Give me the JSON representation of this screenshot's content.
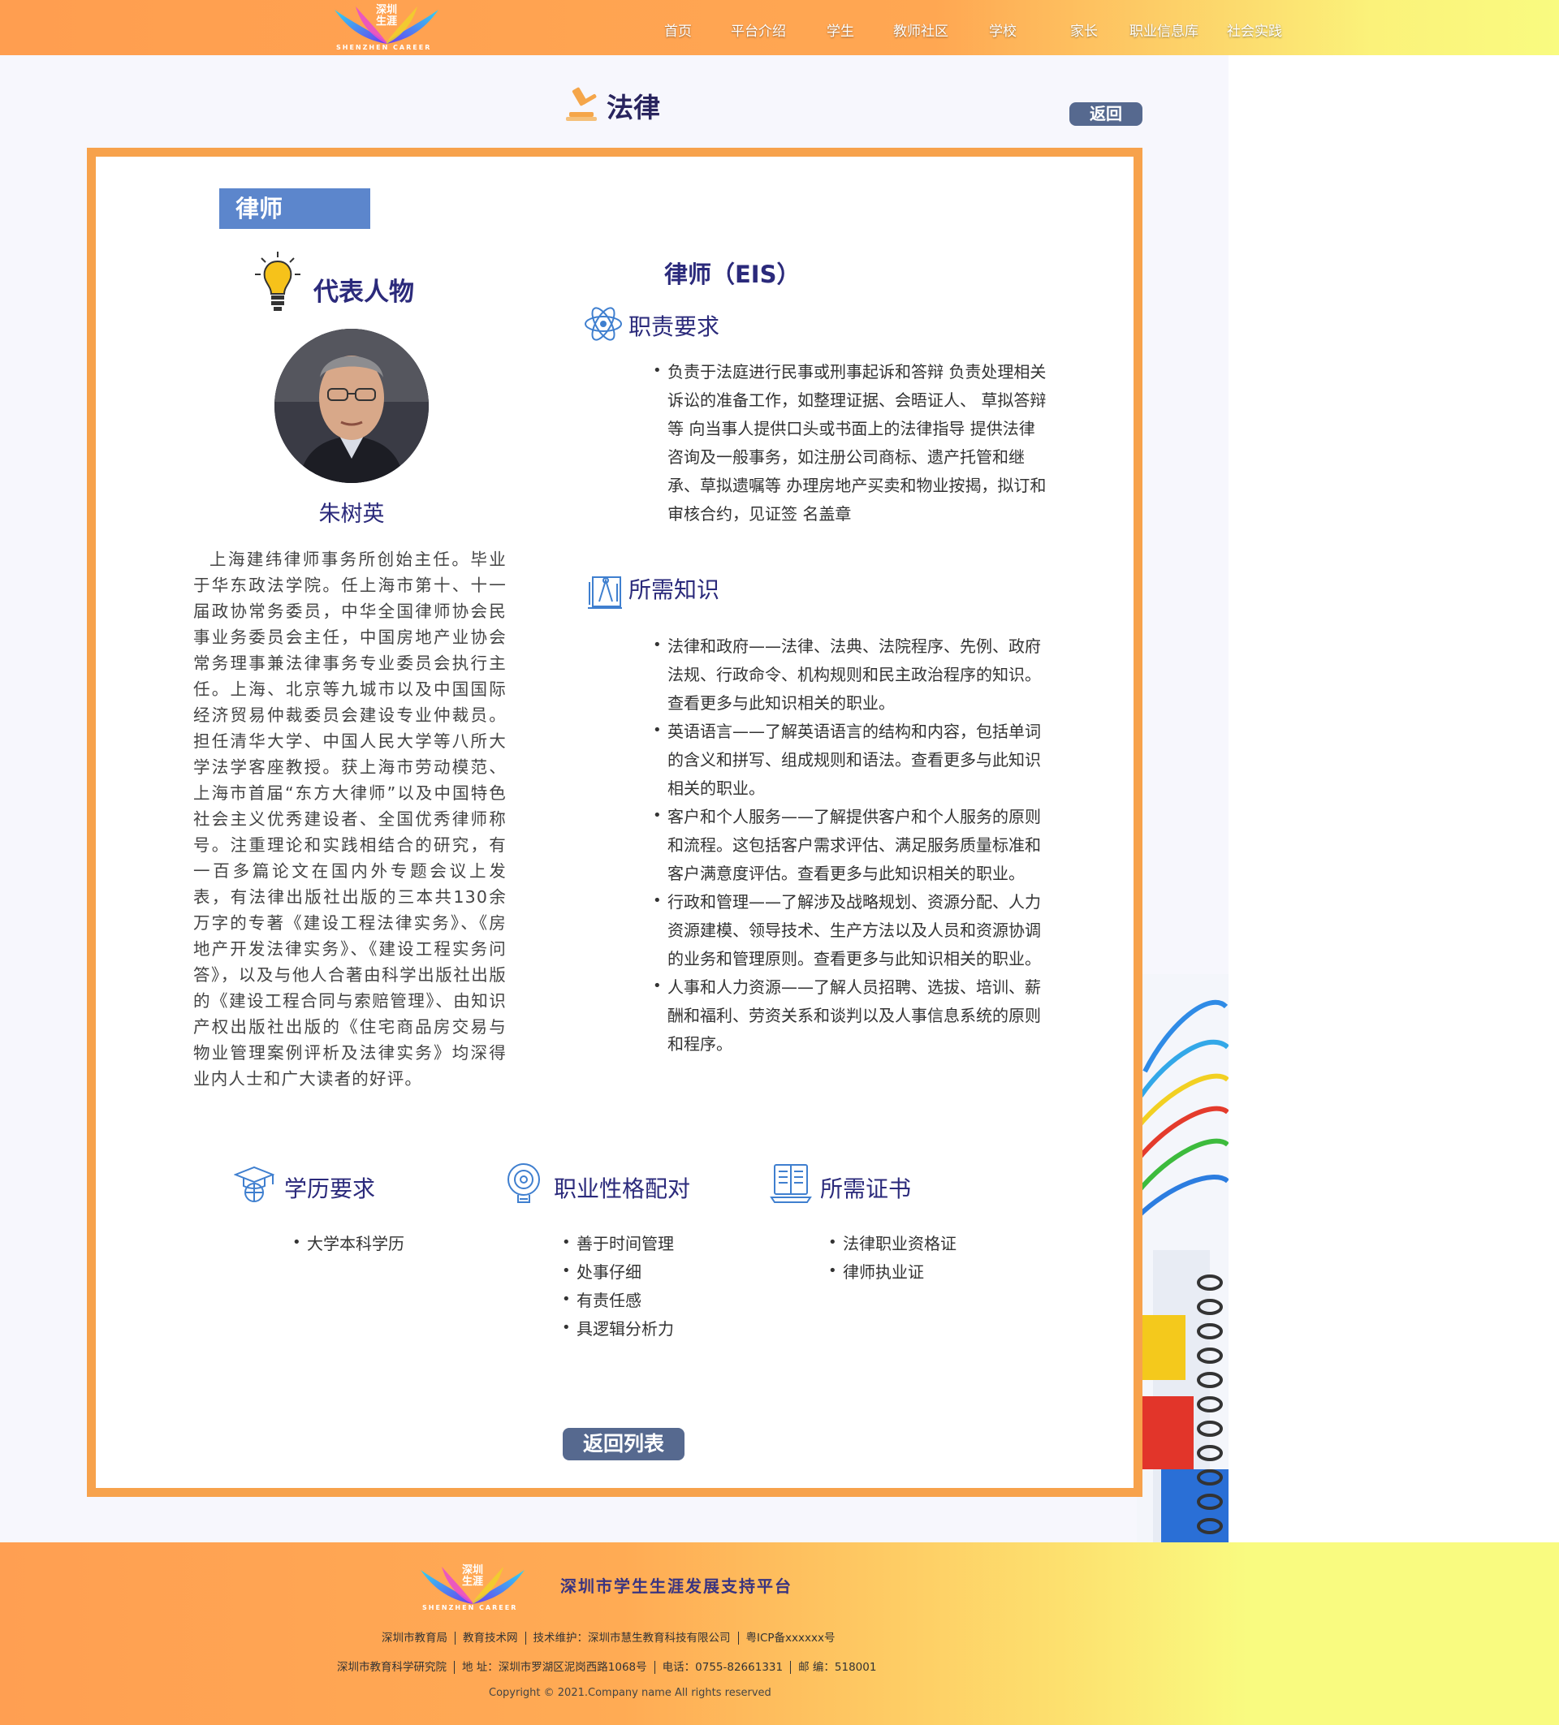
{
  "brand": {
    "logo_cn_line1": "深圳",
    "logo_cn_line2": "生涯",
    "logo_en": "SHENZHEN CAREER"
  },
  "nav": {
    "items": [
      "首页",
      "平台介绍",
      "学生",
      "教师社区",
      "学校",
      "家长",
      "职业信息库",
      "社会实践"
    ]
  },
  "page": {
    "title": "法律",
    "back_label": "返回"
  },
  "card": {
    "tag": "律师",
    "representative": {
      "heading": "代表人物",
      "name": "朱树英",
      "bio": "上海建纬律师事务所创始主任。毕业于华东政法学院。任上海市第十、十一届政协常务委员，中华全国律师协会民事业务委员会主任，中国房地产业协会常务理事兼法律事务专业委员会执行主任。上海、北京等九城市以及中国国际经济贸易仲裁委员会建设专业仲裁员。担任清华大学、中国人民大学等八所大学法学客座教授。获上海市劳动模范、上海市首届“东方大律师”以及中国特色社会主义优秀建设者、全国优秀律师称号。注重理论和实践相结合的研究，有一百多篇论文在国内外专题会议上发表，有法律出版社出版的三本共130余万字的专著《建设工程法律实务》、《房地产开发法律实务》、《建设工程实务问答》，以及与他人合著由科学出版社出版的《建设工程合同与索赔管理》、由知识产权出版社出版的《住宅商品房交易与物业管理案例评析及法律实务》均深得业内人士和广大读者的好评。"
    },
    "eis_title": "律师（EIS）",
    "duties": {
      "heading": "职责要求",
      "items": [
        "负责于法庭进行民事或刑事起诉和答辩 负责处理相关诉讼的准备工作，如整理证据、会晤证人、 草拟答辩等 向当事人提供口头或书面上的法律指导 提供法律咨询及一般事务，如注册公司商标、遗产托管和继承、草拟遗嘱等 办理房地产买卖和物业按揭，拟订和审核合约，见证签 名盖章"
      ]
    },
    "knowledge": {
      "heading": "所需知识",
      "items": [
        "法律和政府——法律、法典、法院程序、先例、政府法规、行政命令、机构规则和民主政治程序的知识。查看更多与此知识相关的职业。",
        "英语语言——了解英语语言的结构和内容，包括单词的含义和拼写、组成规则和语法。查看更多与此知识相关的职业。",
        "客户和个人服务——了解提供客户和个人服务的原则和流程。这包括客户需求评估、满足服务质量标准和客户满意度评估。查看更多与此知识相关的职业。",
        "行政和管理——了解涉及战略规划、资源分配、人力资源建模、领导技术、生产方法以及人员和资源协调的业务和管理原则。查看更多与此知识相关的职业。",
        "人事和人力资源——了解人员招聘、选拔、培训、薪酬和福利、劳资关系和谈判以及人事信息系统的原则和程序。"
      ]
    },
    "education": {
      "heading": "学历要求",
      "items": [
        "大学本科学历"
      ]
    },
    "personality": {
      "heading": "职业性格配对",
      "items": [
        "善于时间管理",
        "处事仔细",
        "有责任感",
        "具逻辑分析力"
      ]
    },
    "certificates": {
      "heading": "所需证书",
      "items": [
        "法律职业资格证",
        "律师执业证"
      ]
    },
    "back_list_label": "返回列表"
  },
  "footer": {
    "platform_name": "深圳市学生生涯发展支持平台",
    "row1": [
      "深圳市教育局",
      "教育技术网",
      "技术维护：深圳市慧生教育科技有限公司",
      "粤ICP备xxxxxx号"
    ],
    "row2": [
      "深圳市教育科学研究院",
      "地  址：深圳市罗湖区泥岗西路1068号",
      "电话：0755-82661331",
      "邮  编：518001"
    ],
    "copyright": "Copyright © 2021.Company name All rights reserved"
  },
  "colors": {
    "header_gradient_start": "#ff9e50",
    "header_gradient_end": "#f9fb80",
    "card_border": "#f7a24c",
    "tag_bg": "#5c86cc",
    "button_bg": "#56698f",
    "heading_text": "#2b2a7b"
  }
}
